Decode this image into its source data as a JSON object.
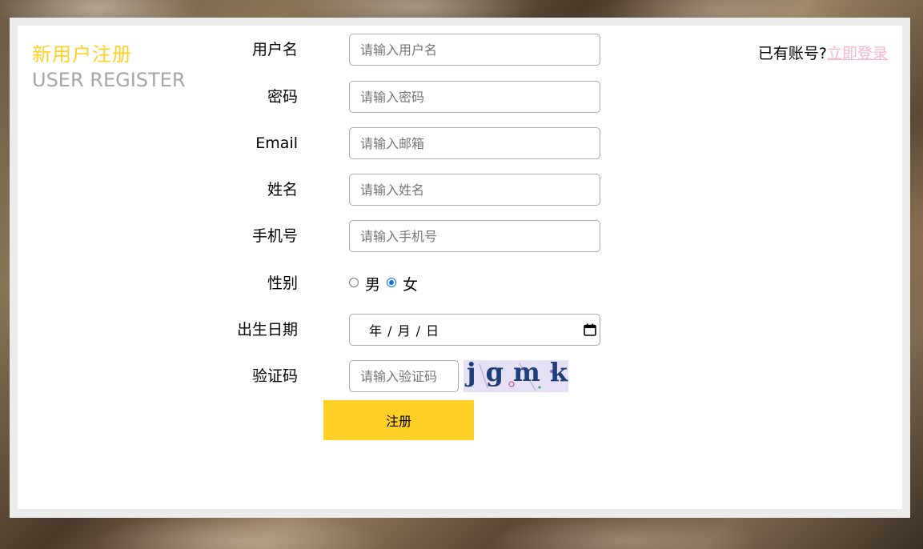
{
  "page": {
    "title_cn": "新用户注册",
    "title_en": "USER REGISTER"
  },
  "login_hint": {
    "text": "已有账号?",
    "link": "立即登录"
  },
  "form": {
    "username": {
      "label": "用户名",
      "placeholder": "请输入用户名",
      "value": ""
    },
    "password": {
      "label": "密码",
      "placeholder": "请输入密码",
      "value": ""
    },
    "email": {
      "label": "Email",
      "placeholder": "请输入邮箱",
      "value": ""
    },
    "name": {
      "label": "姓名",
      "placeholder": "请输入姓名",
      "value": ""
    },
    "phone": {
      "label": "手机号",
      "placeholder": "请输入手机号",
      "value": ""
    },
    "gender": {
      "label": "性别",
      "options": [
        {
          "label": "男",
          "checked": false
        },
        {
          "label": "女",
          "checked": true
        }
      ]
    },
    "birthday": {
      "label": "出生日期",
      "display": "年 / 月 / 日"
    },
    "captcha": {
      "label": "验证码",
      "placeholder": "请输入验证码",
      "image_text": "jgmkj"
    },
    "submit_label": "注册"
  },
  "colors": {
    "accent_yellow": "#ffd026",
    "subtitle_gray": "#a6a6a6",
    "link_pink": "#f5b5cf",
    "radio_blue": "#0b73e6"
  },
  "icons": {
    "calendar": "calendar-icon"
  }
}
